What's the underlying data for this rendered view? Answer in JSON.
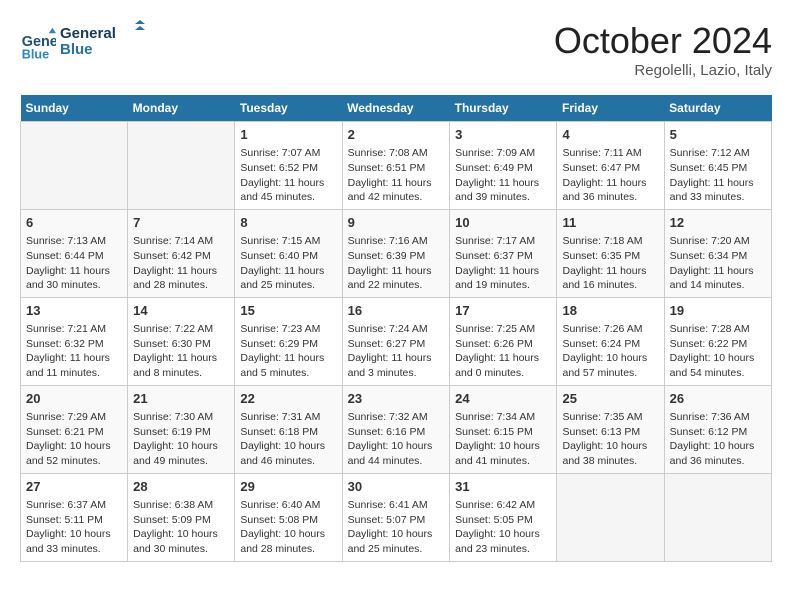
{
  "header": {
    "logo_line1": "General",
    "logo_line2": "Blue",
    "month": "October 2024",
    "location": "Regolelli, Lazio, Italy"
  },
  "weekdays": [
    "Sunday",
    "Monday",
    "Tuesday",
    "Wednesday",
    "Thursday",
    "Friday",
    "Saturday"
  ],
  "weeks": [
    [
      null,
      null,
      {
        "day": 1,
        "sunrise": "7:07 AM",
        "sunset": "6:52 PM",
        "daylight": "11 hours and 45 minutes."
      },
      {
        "day": 2,
        "sunrise": "7:08 AM",
        "sunset": "6:51 PM",
        "daylight": "11 hours and 42 minutes."
      },
      {
        "day": 3,
        "sunrise": "7:09 AM",
        "sunset": "6:49 PM",
        "daylight": "11 hours and 39 minutes."
      },
      {
        "day": 4,
        "sunrise": "7:11 AM",
        "sunset": "6:47 PM",
        "daylight": "11 hours and 36 minutes."
      },
      {
        "day": 5,
        "sunrise": "7:12 AM",
        "sunset": "6:45 PM",
        "daylight": "11 hours and 33 minutes."
      }
    ],
    [
      {
        "day": 6,
        "sunrise": "7:13 AM",
        "sunset": "6:44 PM",
        "daylight": "11 hours and 30 minutes."
      },
      {
        "day": 7,
        "sunrise": "7:14 AM",
        "sunset": "6:42 PM",
        "daylight": "11 hours and 28 minutes."
      },
      {
        "day": 8,
        "sunrise": "7:15 AM",
        "sunset": "6:40 PM",
        "daylight": "11 hours and 25 minutes."
      },
      {
        "day": 9,
        "sunrise": "7:16 AM",
        "sunset": "6:39 PM",
        "daylight": "11 hours and 22 minutes."
      },
      {
        "day": 10,
        "sunrise": "7:17 AM",
        "sunset": "6:37 PM",
        "daylight": "11 hours and 19 minutes."
      },
      {
        "day": 11,
        "sunrise": "7:18 AM",
        "sunset": "6:35 PM",
        "daylight": "11 hours and 16 minutes."
      },
      {
        "day": 12,
        "sunrise": "7:20 AM",
        "sunset": "6:34 PM",
        "daylight": "11 hours and 14 minutes."
      }
    ],
    [
      {
        "day": 13,
        "sunrise": "7:21 AM",
        "sunset": "6:32 PM",
        "daylight": "11 hours and 11 minutes."
      },
      {
        "day": 14,
        "sunrise": "7:22 AM",
        "sunset": "6:30 PM",
        "daylight": "11 hours and 8 minutes."
      },
      {
        "day": 15,
        "sunrise": "7:23 AM",
        "sunset": "6:29 PM",
        "daylight": "11 hours and 5 minutes."
      },
      {
        "day": 16,
        "sunrise": "7:24 AM",
        "sunset": "6:27 PM",
        "daylight": "11 hours and 3 minutes."
      },
      {
        "day": 17,
        "sunrise": "7:25 AM",
        "sunset": "6:26 PM",
        "daylight": "11 hours and 0 minutes."
      },
      {
        "day": 18,
        "sunrise": "7:26 AM",
        "sunset": "6:24 PM",
        "daylight": "10 hours and 57 minutes."
      },
      {
        "day": 19,
        "sunrise": "7:28 AM",
        "sunset": "6:22 PM",
        "daylight": "10 hours and 54 minutes."
      }
    ],
    [
      {
        "day": 20,
        "sunrise": "7:29 AM",
        "sunset": "6:21 PM",
        "daylight": "10 hours and 52 minutes."
      },
      {
        "day": 21,
        "sunrise": "7:30 AM",
        "sunset": "6:19 PM",
        "daylight": "10 hours and 49 minutes."
      },
      {
        "day": 22,
        "sunrise": "7:31 AM",
        "sunset": "6:18 PM",
        "daylight": "10 hours and 46 minutes."
      },
      {
        "day": 23,
        "sunrise": "7:32 AM",
        "sunset": "6:16 PM",
        "daylight": "10 hours and 44 minutes."
      },
      {
        "day": 24,
        "sunrise": "7:34 AM",
        "sunset": "6:15 PM",
        "daylight": "10 hours and 41 minutes."
      },
      {
        "day": 25,
        "sunrise": "7:35 AM",
        "sunset": "6:13 PM",
        "daylight": "10 hours and 38 minutes."
      },
      {
        "day": 26,
        "sunrise": "7:36 AM",
        "sunset": "6:12 PM",
        "daylight": "10 hours and 36 minutes."
      }
    ],
    [
      {
        "day": 27,
        "sunrise": "6:37 AM",
        "sunset": "5:11 PM",
        "daylight": "10 hours and 33 minutes."
      },
      {
        "day": 28,
        "sunrise": "6:38 AM",
        "sunset": "5:09 PM",
        "daylight": "10 hours and 30 minutes."
      },
      {
        "day": 29,
        "sunrise": "6:40 AM",
        "sunset": "5:08 PM",
        "daylight": "10 hours and 28 minutes."
      },
      {
        "day": 30,
        "sunrise": "6:41 AM",
        "sunset": "5:07 PM",
        "daylight": "10 hours and 25 minutes."
      },
      {
        "day": 31,
        "sunrise": "6:42 AM",
        "sunset": "5:05 PM",
        "daylight": "10 hours and 23 minutes."
      },
      null,
      null
    ]
  ],
  "labels": {
    "sunrise": "Sunrise:",
    "sunset": "Sunset:",
    "daylight": "Daylight:"
  }
}
